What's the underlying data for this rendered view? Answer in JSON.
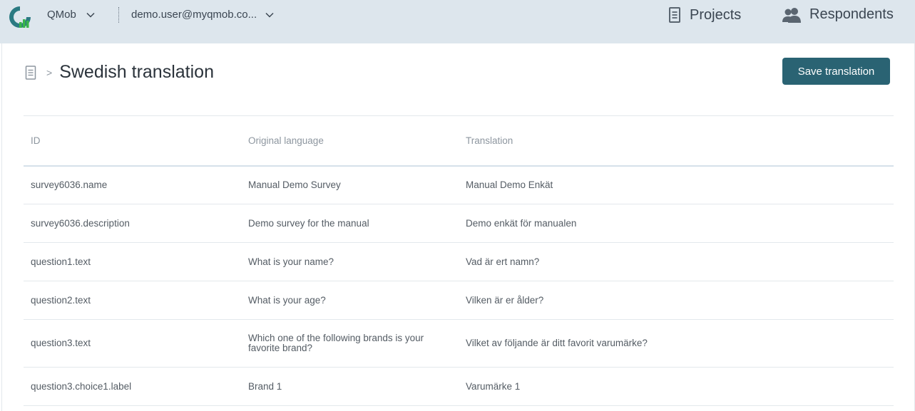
{
  "header": {
    "org_name": "QMob",
    "user_email": "demo.user@myqmob.co...",
    "nav": [
      {
        "label": "Projects",
        "icon": "document-icon"
      },
      {
        "label": "Respondents",
        "icon": "people-icon"
      }
    ]
  },
  "page": {
    "title": "Swedish translation",
    "save_label": "Save translation"
  },
  "table": {
    "columns": [
      "ID",
      "Original language",
      "Translation"
    ],
    "rows": [
      {
        "id": "survey6036.name",
        "original": "Manual Demo Survey",
        "translation": "Manual Demo Enkät"
      },
      {
        "id": "survey6036.description",
        "original": "Demo survey for the manual",
        "translation": "Demo enkät för manualen"
      },
      {
        "id": "question1.text",
        "original": "What is your name?",
        "translation": "Vad är ert namn?"
      },
      {
        "id": "question2.text",
        "original": "What is your age?",
        "translation": "Vilken är er ålder?"
      },
      {
        "id": "question3.text",
        "original": "Which one of the following brands is your favorite brand?",
        "translation": "Vilket av följande är ditt favorit varumärke?"
      },
      {
        "id": "question3.choice1.label",
        "original": "Brand 1",
        "translation": "Varumärke 1"
      }
    ]
  },
  "colors": {
    "topbar": "#dde6ed",
    "accent": "#2a6373",
    "logo_teal": "#2a7a82",
    "logo_green": "#39b54a"
  }
}
